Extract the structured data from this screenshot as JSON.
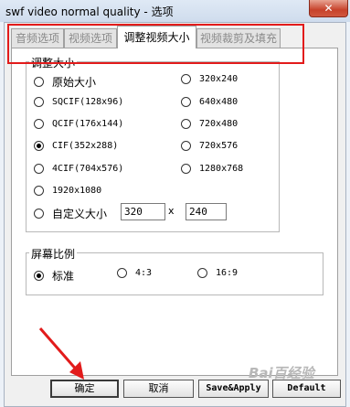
{
  "window": {
    "title": "swf video normal quality - 选项",
    "close_glyph": "✕"
  },
  "tabs": [
    {
      "label": "音频选项",
      "active": false
    },
    {
      "label": "视频选项",
      "active": false
    },
    {
      "label": "调整视频大小",
      "active": true
    },
    {
      "label": "视频裁剪及填充",
      "active": false
    }
  ],
  "size_group": {
    "legend": "调整大小",
    "options": [
      {
        "label": "原始大小",
        "checked": false
      },
      {
        "label": "320x240",
        "checked": false
      },
      {
        "label": "SQCIF(128x96)",
        "checked": false
      },
      {
        "label": "640x480",
        "checked": false
      },
      {
        "label": "QCIF(176x144)",
        "checked": false
      },
      {
        "label": "720x480",
        "checked": false
      },
      {
        "label": "CIF(352x288)",
        "checked": true
      },
      {
        "label": "720x576",
        "checked": false
      },
      {
        "label": "4CIF(704x576)",
        "checked": false
      },
      {
        "label": "1280x768",
        "checked": false
      },
      {
        "label": "1920x1080",
        "checked": false
      },
      {
        "label": "自定义大小",
        "checked": false
      }
    ],
    "custom_width": "320",
    "times_sign": "x",
    "custom_height": "240"
  },
  "ratio_group": {
    "legend": "屏幕比例",
    "options": [
      {
        "label": "标准",
        "checked": true
      },
      {
        "label": "4:3",
        "checked": false
      },
      {
        "label": "16:9",
        "checked": false
      }
    ]
  },
  "buttons": {
    "ok": "确定",
    "cancel": "取消",
    "save_apply": "Save&Apply",
    "default": "Default"
  },
  "watermark": "Bai百经验",
  "colors": {
    "highlight": "#e21b1b"
  }
}
